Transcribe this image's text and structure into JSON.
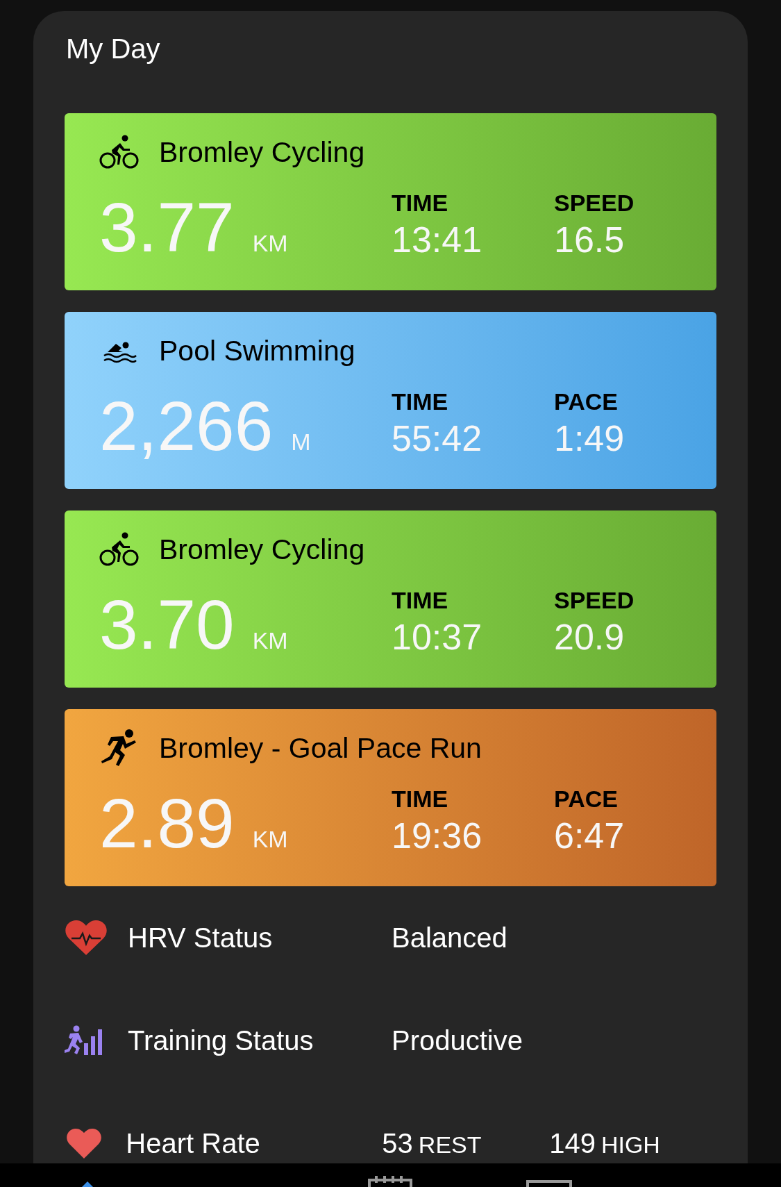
{
  "card": {
    "title": "My Day"
  },
  "activities": [
    {
      "kind": "cycling",
      "name": "Bromley Cycling",
      "distance": "3.77",
      "unit": "KM",
      "stats": [
        {
          "label": "TIME",
          "value": "13:41"
        },
        {
          "label": "SPEED",
          "value": "16.5"
        }
      ]
    },
    {
      "kind": "swimming",
      "name": "Pool Swimming",
      "distance": "2,266",
      "unit": "M",
      "stats": [
        {
          "label": "TIME",
          "value": "55:42"
        },
        {
          "label": "PACE",
          "value": "1:49"
        }
      ]
    },
    {
      "kind": "cycling",
      "name": "Bromley Cycling",
      "distance": "3.70",
      "unit": "KM",
      "stats": [
        {
          "label": "TIME",
          "value": "10:37"
        },
        {
          "label": "SPEED",
          "value": "20.9"
        }
      ]
    },
    {
      "kind": "running",
      "name": "Bromley - Goal Pace Run",
      "distance": "2.89",
      "unit": "KM",
      "stats": [
        {
          "label": "TIME",
          "value": "19:36"
        },
        {
          "label": "PACE",
          "value": "6:47"
        }
      ]
    }
  ],
  "metrics": [
    {
      "kind": "hrv",
      "label": "HRV Status",
      "values": [
        {
          "value": "Balanced"
        }
      ]
    },
    {
      "kind": "training",
      "label": "Training Status",
      "values": [
        {
          "value": "Productive"
        }
      ]
    },
    {
      "kind": "heart",
      "label": "Heart Rate",
      "values": [
        {
          "value": "53",
          "unit": "REST"
        },
        {
          "value": "149",
          "unit": "HIGH"
        }
      ]
    }
  ]
}
